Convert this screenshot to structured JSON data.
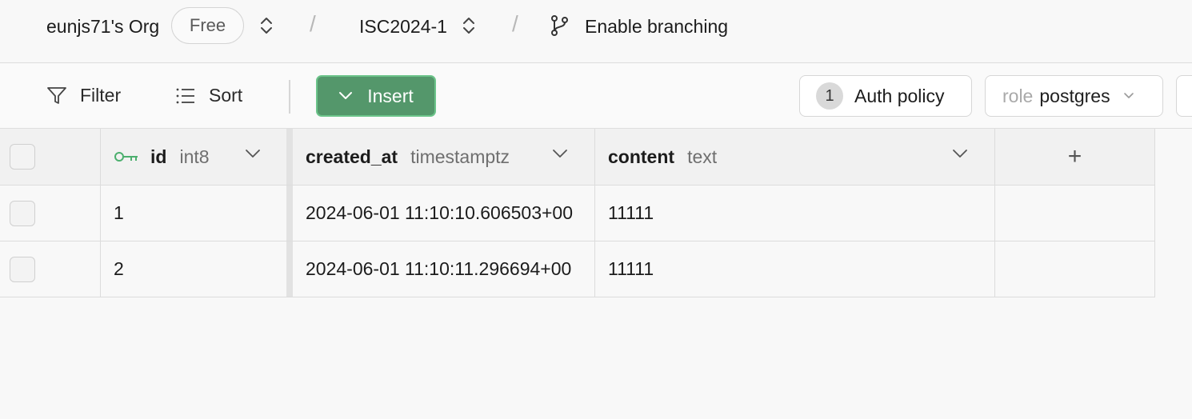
{
  "nav": {
    "org_name": "eunjs71's Org",
    "plan": "Free",
    "separator": "/",
    "project": "ISC2024-1",
    "branching_label": "Enable branching"
  },
  "toolbar": {
    "filter_label": "Filter",
    "sort_label": "Sort",
    "insert_label": "Insert",
    "auth_count": "1",
    "auth_label": "Auth policy",
    "role_key": "role",
    "role_value": "postgres"
  },
  "table": {
    "columns": [
      {
        "name": "id",
        "type": "int8"
      },
      {
        "name": "created_at",
        "type": "timestamptz"
      },
      {
        "name": "content",
        "type": "text"
      }
    ],
    "add_column": "+",
    "rows": [
      {
        "id": "1",
        "created_at": "2024-06-01 11:10:10.606503+00",
        "content": "11111"
      },
      {
        "id": "2",
        "created_at": "2024-06-01 11:10:11.296694+00",
        "content": "11111"
      }
    ]
  },
  "colors": {
    "insert_bg": "#54976b",
    "insert_border": "#6cc48a",
    "key_icon": "#4caf6e"
  },
  "icons": [
    "chevron-up-down-icon",
    "git-branch-icon",
    "filter-icon",
    "sort-list-icon",
    "chevron-down-icon",
    "key-icon",
    "plus-icon"
  ]
}
